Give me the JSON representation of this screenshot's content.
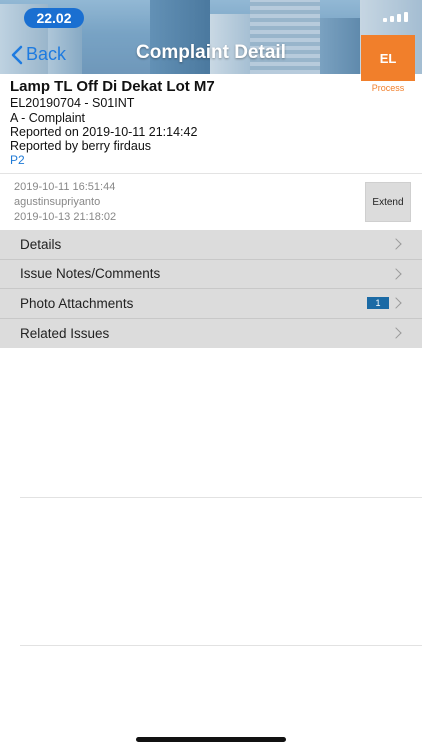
{
  "status_bar": {
    "time": "22.02"
  },
  "nav": {
    "back_label": "Back",
    "title": "Complaint Detail"
  },
  "complaint": {
    "title": "Lamp TL Off Di Dekat Lot M7",
    "code": "EL20190704 - S01INT",
    "category": "A - Complaint",
    "reported_on": "Reported on 2019-10-11 21:14:42",
    "reported_by": "Reported by berry firdaus",
    "priority": "P2",
    "badge": "EL",
    "status": "Process"
  },
  "timeline": {
    "assigned_at": "2019-10-11 16:51:44",
    "assignee": "agustinsupriyanto",
    "due_at": "2019-10-13 21:18:02",
    "extend_label": "Extend"
  },
  "menu": [
    {
      "label": "Details"
    },
    {
      "label": "Issue Notes/Comments"
    },
    {
      "label": "Photo Attachments",
      "count": "1"
    },
    {
      "label": "Related Issues"
    }
  ],
  "colors": {
    "accent": "#1e7be0",
    "status": "#f17f2b",
    "badge": "#1b6aa5"
  }
}
